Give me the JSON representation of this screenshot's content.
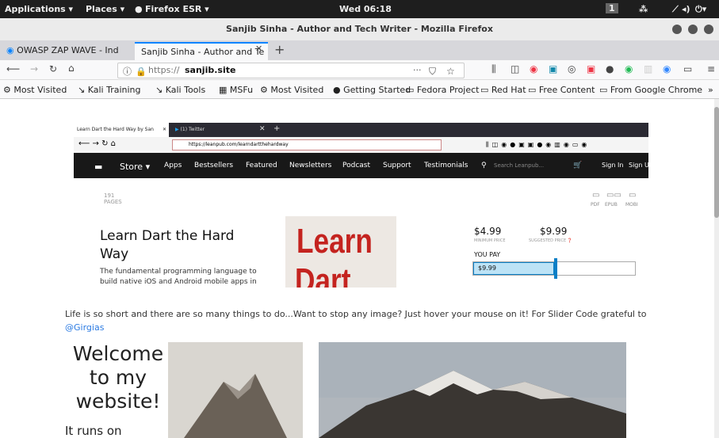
{
  "topbar": {
    "applications": "Applications ▾",
    "places": "Places ▾",
    "browser": "Firefox ESR ▾",
    "clock": "Wed 06:18",
    "workspace": "1"
  },
  "window": {
    "title": "Sanjib Sinha - Author and Tech Writer - Mozilla Firefox"
  },
  "tabs": [
    {
      "label": "OWASP ZAP WAVE - Ind"
    },
    {
      "label": "Sanjib Sinha - Author and Te"
    }
  ],
  "address": {
    "url_prefix": "https://",
    "url_host": "sanjib.site",
    "more": "···"
  },
  "bookmarks": [
    "Most Visited",
    "Kali Training",
    "Kali Tools",
    "MSFu",
    "Most Visited",
    "Getting Started",
    "Fedora Project",
    "Red Hat",
    "Free Content",
    "From Google Chrome"
  ],
  "embedded": {
    "tabs": [
      {
        "label": "Learn Dart the Hard Way by San"
      },
      {
        "label": "(1) Twitter"
      }
    ],
    "url": "https://leanpub.com/learndartthehardway",
    "menu": [
      "Store ▾",
      "Apps",
      "Bestsellers",
      "Featured",
      "Newsletters",
      "Podcast",
      "Support",
      "Testimonials"
    ],
    "search_placeholder": "Search Leanpub...",
    "sign_in": "Sign In",
    "sign_up": "Sign U",
    "pages_count": "191",
    "pages_label": "PAGES",
    "formats": [
      "PDF",
      "EPUB",
      "MOBI"
    ],
    "book_title": "Learn Dart the Hard Way",
    "book_desc": "The fundamental programming language to build native iOS and Android mobile apps in",
    "cover_line1": "Learn",
    "cover_line2": "Dart the",
    "min_price": "$4.99",
    "min_label": "MINIMUM PRICE",
    "sug_price": "$9.99",
    "sug_label": "SUGGESTED PRICE",
    "you_pay": "YOU PAY",
    "pay_value": "$9.99",
    "slider_fraction": 0.5
  },
  "page": {
    "notice": "Life is so short and there are so many things to do...Want to stop any image? Just hover your mouse on it! For Slider Code grateful to",
    "notice_link": "@Girgias",
    "welcome": "Welcome to my website!",
    "runs_on": "It runs on"
  },
  "colors": {
    "accent": "#0a84ff",
    "cover_red": "#c4231f",
    "link": "#2a7ae2"
  }
}
